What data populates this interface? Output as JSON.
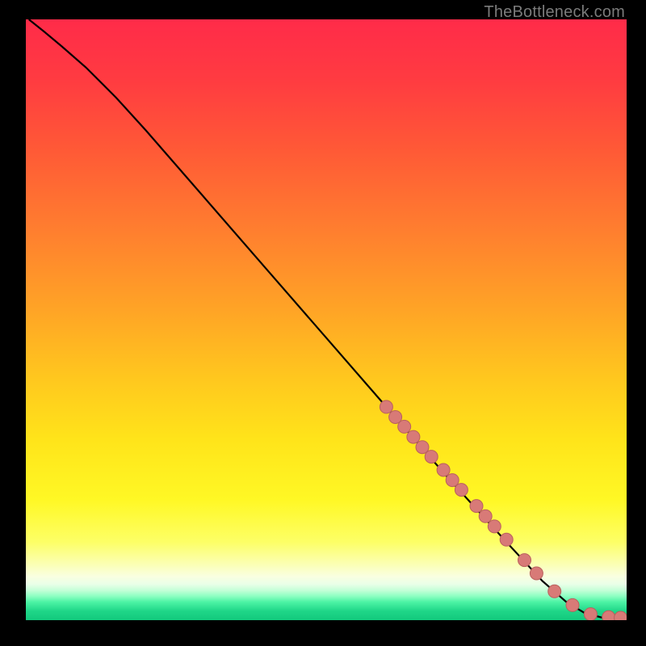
{
  "watermark": "TheBottleneck.com",
  "colors": {
    "frame": "#000000",
    "curve": "#000000",
    "marker_fill": "#d87a77",
    "marker_stroke": "#b9605d",
    "gradient_stops": [
      {
        "offset": 0.0,
        "color": "#ff2b49"
      },
      {
        "offset": 0.1,
        "color": "#ff3b41"
      },
      {
        "offset": 0.22,
        "color": "#ff5a36"
      },
      {
        "offset": 0.35,
        "color": "#ff7e2f"
      },
      {
        "offset": 0.48,
        "color": "#ffa326"
      },
      {
        "offset": 0.6,
        "color": "#ffc81e"
      },
      {
        "offset": 0.7,
        "color": "#ffe41a"
      },
      {
        "offset": 0.8,
        "color": "#fff825"
      },
      {
        "offset": 0.87,
        "color": "#fdff66"
      },
      {
        "offset": 0.905,
        "color": "#fbffb0"
      },
      {
        "offset": 0.927,
        "color": "#f9ffe0"
      },
      {
        "offset": 0.94,
        "color": "#eaffe8"
      },
      {
        "offset": 0.95,
        "color": "#c6ffd8"
      },
      {
        "offset": 0.96,
        "color": "#8dffc2"
      },
      {
        "offset": 0.97,
        "color": "#4bf3a4"
      },
      {
        "offset": 0.985,
        "color": "#1fd688"
      },
      {
        "offset": 1.0,
        "color": "#12c97d"
      }
    ]
  },
  "chart_data": {
    "type": "line",
    "title": "",
    "xlabel": "",
    "ylabel": "",
    "xlim": [
      0,
      100
    ],
    "ylim": [
      0,
      100
    ],
    "grid": false,
    "series": [
      {
        "name": "curve",
        "x": [
          0.5,
          3,
          6,
          10,
          15,
          20,
          30,
          40,
          50,
          60,
          70,
          80,
          86,
          90,
          93,
          96,
          99.5
        ],
        "y": [
          100,
          98,
          95.5,
          92,
          87,
          81.5,
          70,
          58.5,
          47,
          35.5,
          24,
          13,
          6.5,
          3,
          1.2,
          0.4,
          0.3
        ]
      }
    ],
    "markers": {
      "name": "highlighted-points",
      "x": [
        60,
        61.5,
        63,
        64.5,
        66,
        67.5,
        69.5,
        71,
        72.5,
        75,
        76.5,
        78,
        80,
        83,
        85,
        88,
        91,
        94,
        97,
        99
      ],
      "y": [
        35.5,
        33.8,
        32.2,
        30.5,
        28.8,
        27.2,
        25,
        23.3,
        21.7,
        19,
        17.3,
        15.6,
        13.4,
        10,
        7.8,
        4.8,
        2.5,
        1.0,
        0.5,
        0.4
      ]
    }
  }
}
